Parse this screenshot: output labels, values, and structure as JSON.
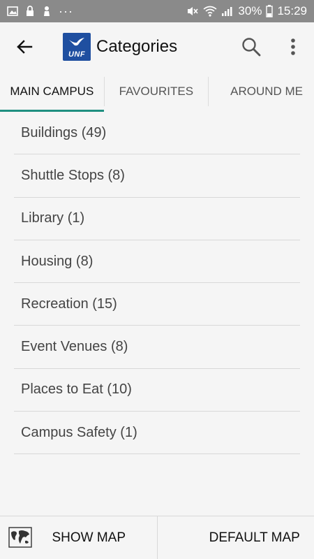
{
  "statusbar": {
    "battery": "30%",
    "time": "15:29",
    "dots": "···"
  },
  "appbar": {
    "title": "Categories",
    "logo_text": "UNF"
  },
  "tabs": [
    {
      "label": "MAIN CAMPUS",
      "active": true
    },
    {
      "label": "FAVOURITES",
      "active": false
    },
    {
      "label": "AROUND ME",
      "active": false
    }
  ],
  "categories": [
    {
      "label": "Buildings (49)"
    },
    {
      "label": "Shuttle Stops (8)"
    },
    {
      "label": "Library (1)"
    },
    {
      "label": "Housing (8)"
    },
    {
      "label": "Recreation (15)"
    },
    {
      "label": "Event Venues (8)"
    },
    {
      "label": "Places to Eat (10)"
    },
    {
      "label": "Campus Safety (1)"
    }
  ],
  "bottombar": {
    "show_map": "SHOW MAP",
    "default_map": "DEFAULT MAP"
  },
  "colors": {
    "accent": "#1f8f80",
    "logo_bg": "#1f4fa0",
    "statusbar_bg": "#8a8a8a"
  }
}
